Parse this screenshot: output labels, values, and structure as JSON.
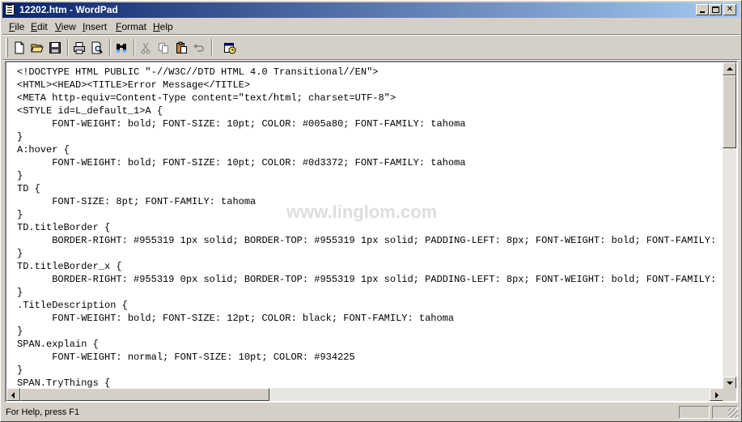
{
  "window": {
    "title": "12202.htm - WordPad"
  },
  "menu": [
    {
      "label": "File",
      "accel": "F",
      "rest": "ile"
    },
    {
      "label": "Edit",
      "accel": "E",
      "rest": "dit"
    },
    {
      "label": "View",
      "accel": "V",
      "rest": "iew"
    },
    {
      "label": "Insert",
      "accel": "I",
      "rest": "nsert"
    },
    {
      "label": "Format",
      "accel": "F",
      "rest": "ormat",
      "prefix": ""
    },
    {
      "label": "Help",
      "accel": "H",
      "rest": "elp"
    }
  ],
  "toolbar": {
    "buttons": [
      "new-icon",
      "open-icon",
      "save-icon",
      "print-icon",
      "print-preview-icon",
      "find-icon",
      "cut-icon",
      "copy-icon",
      "paste-icon",
      "undo-icon",
      "date-time-icon"
    ]
  },
  "document": {
    "lines": [
      "<!DOCTYPE HTML PUBLIC \"-//W3C//DTD HTML 4.0 Transitional//EN\">",
      "<HTML><HEAD><TITLE>Error Message</TITLE>",
      "<META http-equiv=Content-Type content=\"text/html; charset=UTF-8\">",
      "<STYLE id=L_default_1>A {",
      "      FONT-WEIGHT: bold; FONT-SIZE: 10pt; COLOR: #005a80; FONT-FAMILY: tahoma",
      "}",
      "A:hover {",
      "      FONT-WEIGHT: bold; FONT-SIZE: 10pt; COLOR: #0d3372; FONT-FAMILY: tahoma",
      "}",
      "TD {",
      "      FONT-SIZE: 8pt; FONT-FAMILY: tahoma",
      "}",
      "TD.titleBorder {",
      "      BORDER-RIGHT: #955319 1px solid; BORDER-TOP: #955319 1px solid; PADDING-LEFT: 8px; FONT-WEIGHT: bold; FONT-FAMILY: tahoma",
      "}",
      "TD.titleBorder_x {",
      "      BORDER-RIGHT: #955319 0px solid; BORDER-TOP: #955319 1px solid; PADDING-LEFT: 8px; FONT-WEIGHT: bold; FONT-FAMILY: tahoma",
      "}",
      ".TitleDescription {",
      "      FONT-WEIGHT: bold; FONT-SIZE: 12pt; COLOR: black; FONT-FAMILY: tahoma",
      "}",
      "SPAN.explain {",
      "      FONT-WEIGHT: normal; FONT-SIZE: 10pt; COLOR: #934225",
      "}",
      "SPAN.TryThings {"
    ]
  },
  "watermark": "www.linglom.com",
  "status": {
    "text": "For Help, press F1"
  }
}
